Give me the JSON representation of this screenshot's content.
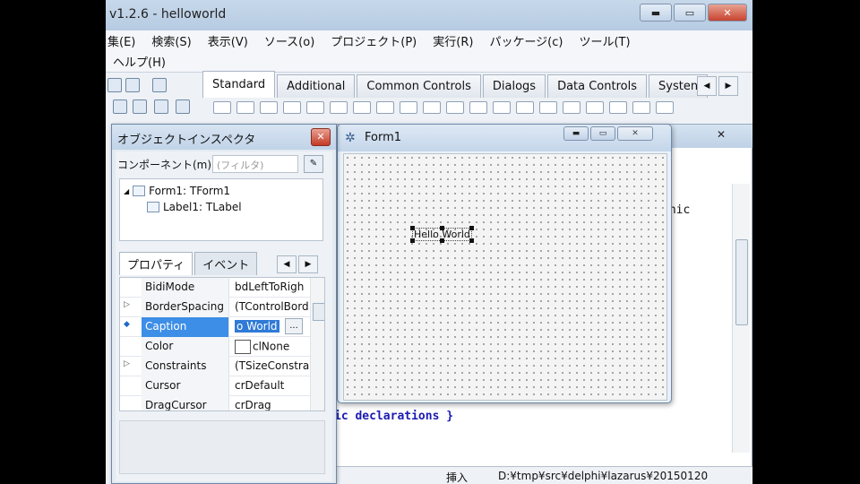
{
  "main_window": {
    "title": "v1.2.6 - helloworld",
    "menu_row1": [
      "集(E)",
      "検索(S)",
      "表示(V)",
      "ソース(o)",
      "プロジェクト(P)",
      "実行(R)",
      "パッケージ(c)",
      "ツール(T)"
    ],
    "menu_row2": [
      "ヘルプ(H)"
    ],
    "controls": {
      "minimize": "▬",
      "maximize": "▭",
      "close": "✕"
    }
  },
  "palette_tabs": [
    "Standard",
    "Additional",
    "Common Controls",
    "Dialogs",
    "Data Controls",
    "Systen"
  ],
  "active_palette_tab": "Standard",
  "editor": {
    "code_fragment_1": "phic",
    "code_fragment_2": "ic declarations }",
    "close": "✕"
  },
  "status_bar": {
    "mode": "挿入",
    "path": "D:¥tmp¥src¥delphi¥lazarus¥20150120"
  },
  "form_designer": {
    "title": "Form1",
    "label_caption": "Hello World"
  },
  "object_inspector": {
    "title": "オブジェクトインスペクタ",
    "component_label": "コンポーネント(m)",
    "filter_placeholder": "(フィルタ)",
    "tree": [
      {
        "text": "Form1: TForm1"
      },
      {
        "text": "Label1: TLabel"
      }
    ],
    "tabs": [
      "プロパティ",
      "イベント"
    ],
    "properties": [
      {
        "name": "BidiMode",
        "value": "bdLeftToRigh",
        "marker": ""
      },
      {
        "name": "BorderSpacing",
        "value": "(TControlBord",
        "marker": "▷"
      },
      {
        "name": "Caption",
        "value": "o World",
        "marker": "◆",
        "selected": true
      },
      {
        "name": "Color",
        "value": "clNone",
        "marker": ""
      },
      {
        "name": "Constraints",
        "value": "(TSizeConstra",
        "marker": "▷"
      },
      {
        "name": "Cursor",
        "value": "crDefault",
        "marker": ""
      },
      {
        "name": "DragCursor",
        "value": "crDrag",
        "marker": ""
      }
    ]
  }
}
